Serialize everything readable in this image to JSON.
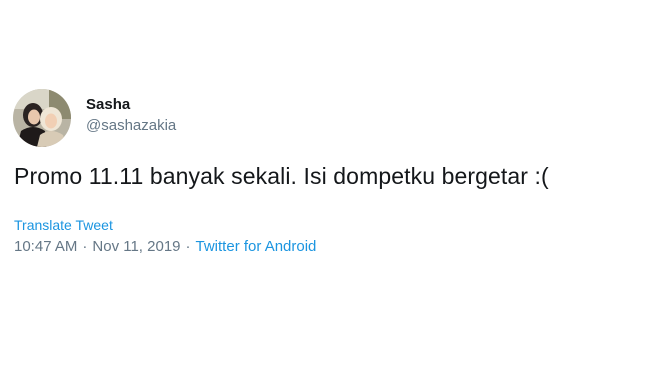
{
  "author": {
    "name": "Sasha",
    "handle": "@sashazakia"
  },
  "tweet": {
    "text": "Promo 11.11 banyak sekali. Isi dompetku bergetar :(",
    "translate_label": "Translate Tweet",
    "time": "10:47 AM",
    "date": "Nov 11, 2019",
    "source": "Twitter for Android",
    "separator": "·"
  },
  "colors": {
    "text": "#14171a",
    "secondary": "#657786",
    "link": "#1b95e0"
  }
}
